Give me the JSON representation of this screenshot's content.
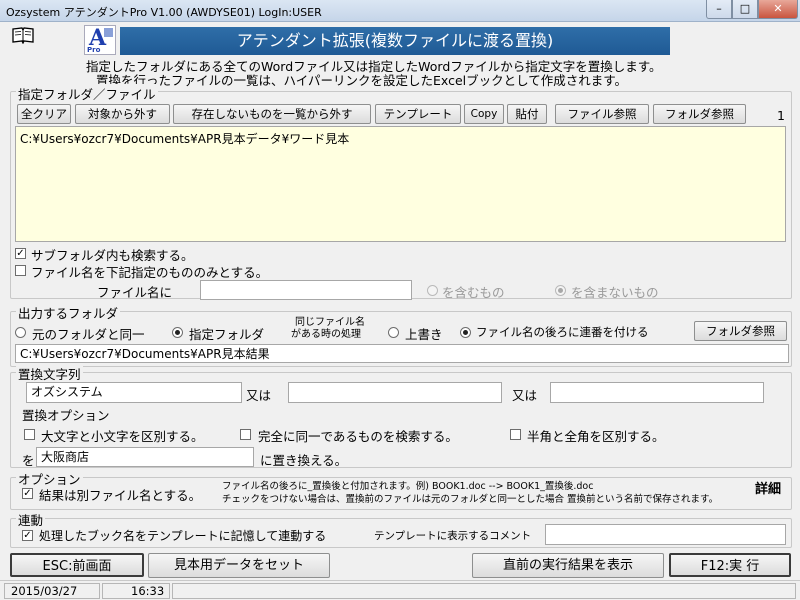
{
  "window": {
    "title": "Ozsystem アテンダントPro V1.00 (AWDYSE01)  LogIn:USER",
    "minimize": "–",
    "maximize": "□",
    "close": "✕"
  },
  "header": {
    "logo_letter": "A",
    "logo_sub": "Pro",
    "banner": "アテンダント拡張(複数ファイルに渡る置換)",
    "desc_line1": "指定したフォルダにある全てのWordファイル又は指定したWordファイルから指定文字を置換します。",
    "desc_line2": "置換を行ったファイルの一覧は、ハイパーリンクを設定したExcelブックとして作成されます。"
  },
  "target": {
    "legend": "指定フォルダ／ファイル",
    "buttons": {
      "clear_all": "全クリア",
      "remove": "対象から外す",
      "remove_missing": "存在しないものを一覧から外す",
      "template": "テンプレート",
      "copy": "Copy",
      "paste": "貼付",
      "file_browse": "ファイル参照",
      "folder_browse": "フォルダ参照"
    },
    "count": "1",
    "paths": "C:¥Users¥ozcr7¥Documents¥APR見本データ¥ワード見本",
    "subfolder_label": "サブフォルダ内も検索する。",
    "subfolder_checked": true,
    "filter_label": "ファイル名を下記指定のもののみとする。",
    "filter_checked": false,
    "filename_label": "ファイル名に",
    "filename_value": "",
    "include_label": "を含むもの",
    "exclude_label": "を含まないもの"
  },
  "output": {
    "legend": "出力するフォルダ",
    "same_folder": "元のフォルダと同一",
    "specified_folder": "指定フォルダ",
    "same_name_line1": "同じファイル名",
    "same_name_line2": "がある時の処理",
    "overwrite": "上書き",
    "add_number": "ファイル名の後ろに連番を付ける",
    "folder_browse": "フォルダ参照",
    "path": "C:¥Users¥ozcr7¥Documents¥APR見本結果"
  },
  "replace": {
    "legend": "置換文字列",
    "search1": "オズシステム",
    "or1": "又は",
    "search2": "",
    "or2": "又は",
    "search3": "",
    "options_label": "置換オプション",
    "case_label": "大文字と小文字を区別する。",
    "whole_label": "完全に同一であるものを検索する。",
    "width_label": "半角と全角を区別する。",
    "wo": "を",
    "replace_value": "大阪商店",
    "replace_suffix": "に置き換える。"
  },
  "option": {
    "legend": "オプション",
    "other_file_label": "結果は別ファイル名とする。",
    "other_file_checked": true,
    "note1": "ファイル名の後ろに_置換後と付加されます。例) BOOK1.doc --> BOOK1_置換後.doc",
    "note2": "チェックをつけない場合は、置換前のファイルは元のフォルダと同一とした場合 置換前という名前で保存されます。",
    "detail": "詳細"
  },
  "link": {
    "legend": "連動",
    "remember_label": "処理したブック名をテンプレートに記憶して連動する",
    "remember_checked": true,
    "comment_label": "テンプレートに表示するコメント",
    "comment_value": ""
  },
  "footer": {
    "back": "ESC:前画面",
    "sample": "見本用データをセット",
    "show_last": "直前の実行結果を表示",
    "run": "F12:実 行"
  },
  "status": {
    "date": "2015/03/27",
    "time": "16:33"
  }
}
